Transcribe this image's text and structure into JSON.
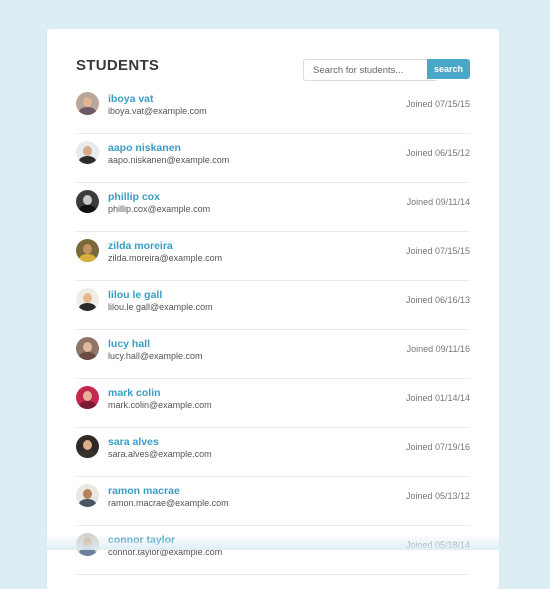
{
  "header": {
    "title": "STUDENTS",
    "search_placeholder": "Search for students...",
    "search_button": "search"
  },
  "students": [
    {
      "name": "iboya vat",
      "email": "iboya.vat@example.com",
      "joined": "Joined 07/15/15",
      "avatar_bg": "#b9a79b",
      "skin": "#e3b48f",
      "shirt": "#6d5a66"
    },
    {
      "name": "aapo niskanen",
      "email": "aapo.niskanen@example.com",
      "joined": "Joined 06/15/12",
      "avatar_bg": "#e8ecee",
      "skin": "#d9a98a",
      "shirt": "#2c2c2c"
    },
    {
      "name": "phillip cox",
      "email": "phillip.cox@example.com",
      "joined": "Joined 09/11/14",
      "avatar_bg": "#3b3b3b",
      "skin": "#c8c8c8",
      "shirt": "#111111"
    },
    {
      "name": "zilda moreira",
      "email": "zilda.moreira@example.com",
      "joined": "Joined 07/15/15",
      "avatar_bg": "#7a6a3a",
      "skin": "#c79260",
      "shirt": "#d6b23a"
    },
    {
      "name": "lilou le gall",
      "email": "lilou.le gall@example.com",
      "joined": "Joined 06/16/13",
      "avatar_bg": "#f1ece6",
      "skin": "#e6b894",
      "shirt": "#2a2a2a"
    },
    {
      "name": "lucy hall",
      "email": "lucy.hall@example.com",
      "joined": "Joined 09/11/16",
      "avatar_bg": "#8f7468",
      "skin": "#e2b89c",
      "shirt": "#6a4b44"
    },
    {
      "name": "mark colin",
      "email": "mark.colin@example.com",
      "joined": "Joined 01/14/14",
      "avatar_bg": "#c1294d",
      "skin": "#e4b29a",
      "shirt": "#7a1d33"
    },
    {
      "name": "sara alves",
      "email": "sara.alves@example.com",
      "joined": "Joined 07/19/16",
      "avatar_bg": "#2f2a26",
      "skin": "#d9b08e",
      "shirt": "#3a332c"
    },
    {
      "name": "ramon macrae",
      "email": "ramon.macrae@example.com",
      "joined": "Joined 05/13/12",
      "avatar_bg": "#eae6e2",
      "skin": "#b5835f",
      "shirt": "#4a5564"
    },
    {
      "name": "connor taylor",
      "email": "connor.taylor@example.com",
      "joined": "Joined 05/18/14",
      "avatar_bg": "#d4d0cc",
      "skin": "#d8a98a",
      "shirt": "#6b7f99"
    }
  ]
}
